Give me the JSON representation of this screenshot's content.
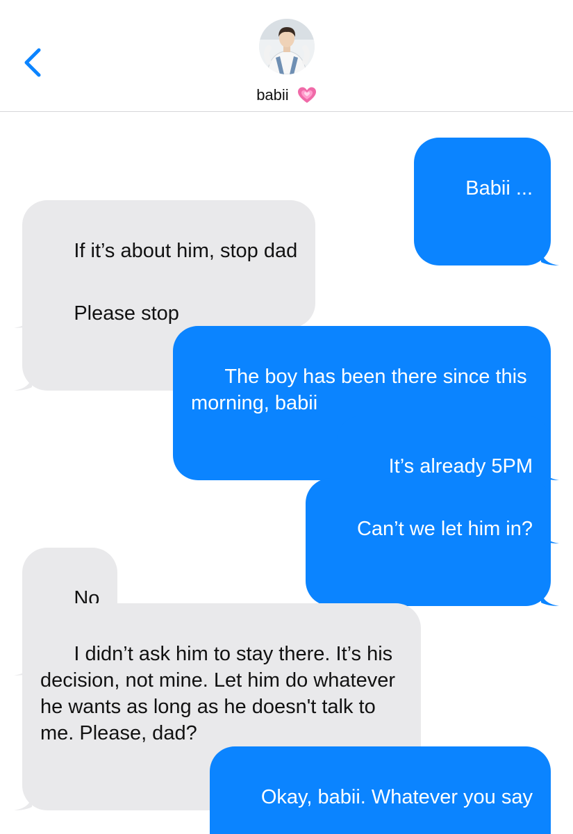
{
  "header": {
    "back_icon": "chevron-left-icon",
    "contact_name": "babii",
    "name_emoji_icon": "growing-heart-icon",
    "accent_color": "#0b84ff"
  },
  "messages": [
    {
      "direction": "sent",
      "text": "Babii ..."
    },
    {
      "direction": "received",
      "text": "If it’s about him, stop dad"
    },
    {
      "direction": "received",
      "text": "Please stop"
    },
    {
      "direction": "sent",
      "text": "The boy has been there since this morning, babii"
    },
    {
      "direction": "sent",
      "text": "It’s already 5PM"
    },
    {
      "direction": "sent",
      "text": "Can’t we let him in?"
    },
    {
      "direction": "received",
      "text": "No"
    },
    {
      "direction": "received",
      "text": "I didn’t ask him to stay there. It’s his decision, not mine. Let him do whatever he wants as long as he doesn't talk to me. Please, dad?"
    },
    {
      "direction": "sent",
      "text": "Okay, babii. Whatever you say"
    }
  ],
  "colors": {
    "sent_bubble": "#0b84ff",
    "received_bubble": "#e9e9eb"
  }
}
